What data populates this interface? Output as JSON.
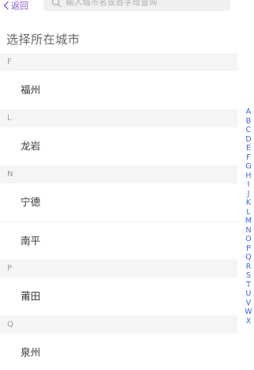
{
  "header": {
    "back_label": "返回",
    "search_placeholder": "输入城市名或首字母查询"
  },
  "page": {
    "title": "选择所在城市"
  },
  "groups": [
    {
      "letter": "F",
      "cities": [
        "福州"
      ]
    },
    {
      "letter": "L",
      "cities": [
        "龙岩"
      ]
    },
    {
      "letter": "N",
      "cities": [
        "宁德",
        "南平"
      ]
    },
    {
      "letter": "P",
      "cities": [
        "莆田"
      ]
    },
    {
      "letter": "Q",
      "cities": [
        "泉州"
      ]
    }
  ],
  "index_letters": [
    "A",
    "B",
    "C",
    "D",
    "E",
    "F",
    "G",
    "H",
    "I",
    "J",
    "K",
    "L",
    "M",
    "N",
    "O",
    "P",
    "Q",
    "R",
    "S",
    "T",
    "U",
    "V",
    "W",
    "X"
  ],
  "colors": {
    "accent": "#8b57d6",
    "index": "#3d67e8",
    "group_bg": "#f5f5f5"
  },
  "icons": {
    "back": "chevron-left-icon",
    "search": "search-icon"
  }
}
